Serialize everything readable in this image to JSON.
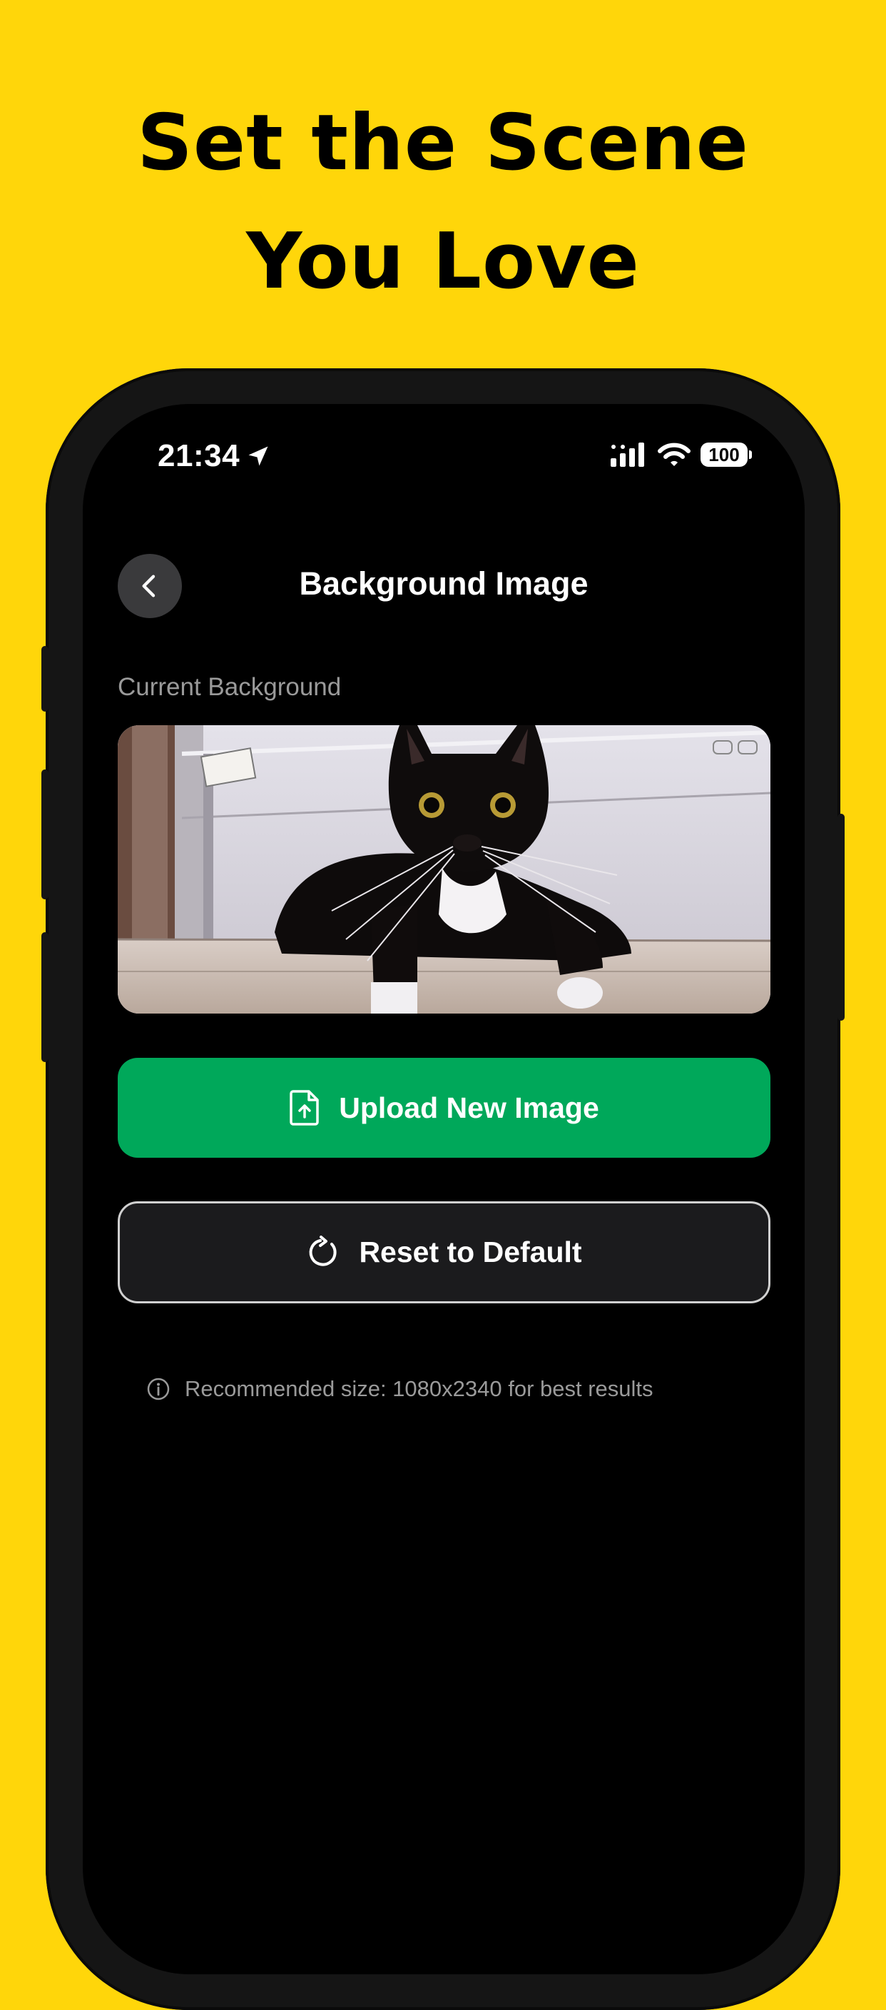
{
  "headline": {
    "line1": "Set the Scene",
    "line2": "You Love"
  },
  "status_bar": {
    "time": "21:34",
    "battery": "100"
  },
  "header": {
    "title": "Background Image"
  },
  "section_label": "Current Background",
  "buttons": {
    "upload": "Upload New Image",
    "reset": "Reset to Default"
  },
  "hint": "Recommended size: 1080x2340 for best results",
  "colors": {
    "background": "#FFD60A",
    "upload_button": "#00A85A",
    "screen": "#000000"
  },
  "icons": {
    "location": "location-arrow-icon",
    "signal": "cellular-signal-icon",
    "wifi": "wifi-icon",
    "back": "chevron-left-icon",
    "upload": "file-upload-icon",
    "reset": "rotate-cw-icon",
    "info": "info-icon"
  }
}
